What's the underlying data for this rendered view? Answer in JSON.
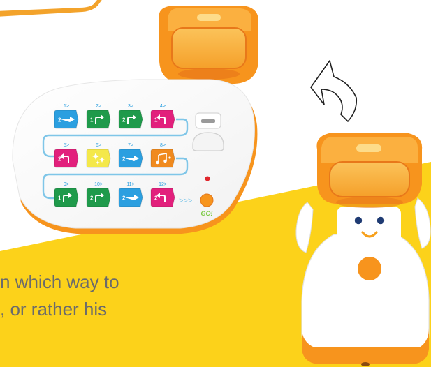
{
  "colors": {
    "yellow_bg": "#fcd21a",
    "orange": "#f7941d",
    "dark_orange": "#e8781a",
    "blue_tile": "#2b9fe0",
    "green_tile": "#1f9a4b",
    "magenta_tile": "#e2207c",
    "yellow_tile": "#f4e84a",
    "orange_tile": "#f08a1e",
    "go_green": "#7ac943",
    "robot_eye": "#1f3b73"
  },
  "board": {
    "rows": [
      {
        "cells": [
          {
            "label": "1>",
            "digit": "2",
            "kind": "forward",
            "icon": "right-arrow-icon",
            "color": "#2b9fe0"
          },
          {
            "label": "2>",
            "digit": "1",
            "kind": "turn-right",
            "icon": "turn-right-icon",
            "color": "#1f9a4b"
          },
          {
            "label": "3>",
            "digit": "2",
            "kind": "turn-right",
            "icon": "turn-right-icon",
            "color": "#1f9a4b"
          },
          {
            "label": "4>",
            "digit": "1",
            "kind": "turn-left",
            "icon": "turn-left-icon",
            "color": "#e2207c"
          }
        ]
      },
      {
        "cells": [
          {
            "label": "5>",
            "digit": "2",
            "kind": "turn-left",
            "icon": "turn-left-icon",
            "color": "#e2207c"
          },
          {
            "label": "6>",
            "digit": "",
            "kind": "sparkle",
            "icon": "sparkle-icon",
            "color": "#f4e84a"
          },
          {
            "label": "7>",
            "digit": "2",
            "kind": "forward",
            "icon": "right-arrow-icon",
            "color": "#2b9fe0"
          },
          {
            "label": "8>",
            "digit": "",
            "kind": "music",
            "icon": "music-notes-icon",
            "color": "#f08a1e"
          }
        ]
      },
      {
        "cells": [
          {
            "label": "9>",
            "digit": "1",
            "kind": "turn-right",
            "icon": "turn-right-icon",
            "color": "#1f9a4b"
          },
          {
            "label": "10>",
            "digit": "2",
            "kind": "turn-right",
            "icon": "turn-right-icon",
            "color": "#1f9a4b"
          },
          {
            "label": "11>",
            "digit": "2",
            "kind": "forward",
            "icon": "right-arrow-icon",
            "color": "#2b9fe0"
          },
          {
            "label": "12>",
            "digit": "2",
            "kind": "turn-left",
            "icon": "turn-left-icon",
            "color": "#e2207c"
          }
        ]
      }
    ],
    "chevrons": ">>>",
    "go_label": "GO!"
  },
  "caption": {
    "line1": "n which way to",
    "line2": ", or rather his"
  }
}
